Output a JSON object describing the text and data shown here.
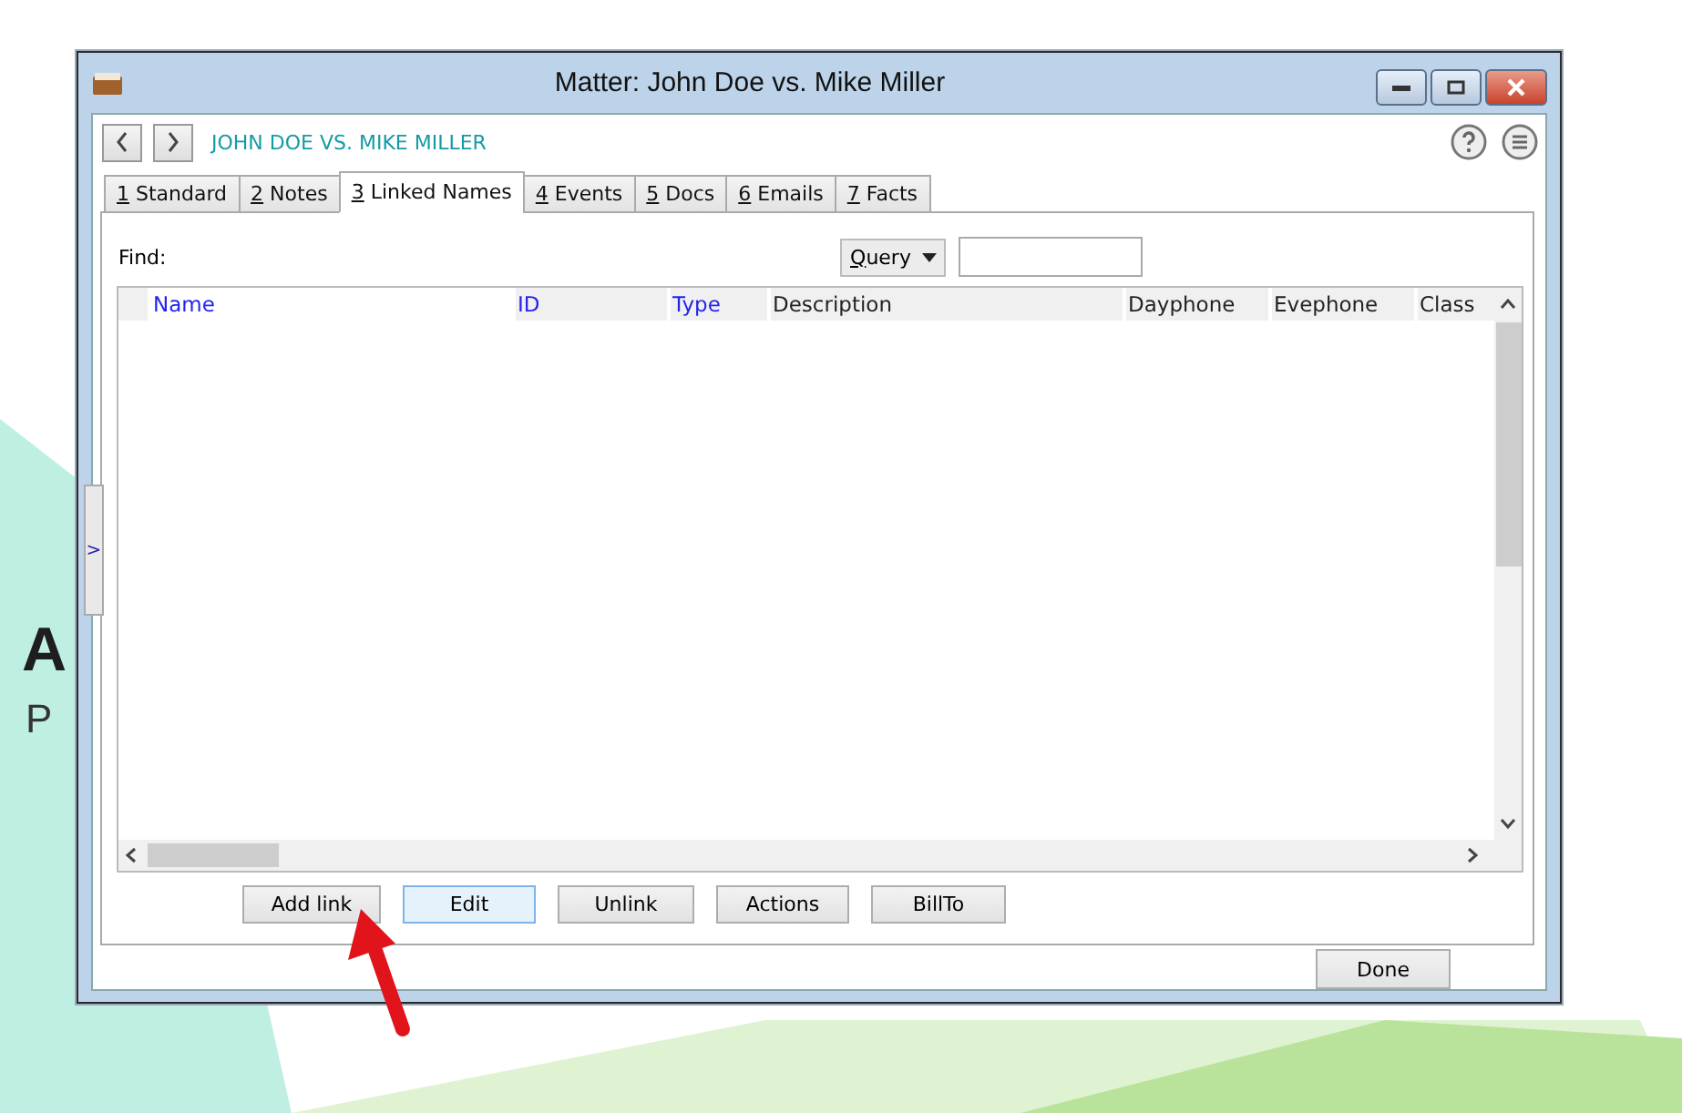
{
  "background_logo": {
    "mark": "A",
    "tagline": "P"
  },
  "window": {
    "title": "Matter: John Doe vs. Mike Miller"
  },
  "matter_heading": "JOHN DOE VS. MIKE MILLER",
  "tabs": [
    {
      "key": "1",
      "text": "Standard",
      "selected": false
    },
    {
      "key": "2",
      "text": "Notes",
      "selected": false
    },
    {
      "key": "3",
      "text": "Linked Names",
      "selected": true
    },
    {
      "key": "4",
      "text": "Events",
      "selected": false
    },
    {
      "key": "5",
      "text": "Docs",
      "selected": false
    },
    {
      "key": "6",
      "text": "Emails",
      "selected": false
    },
    {
      "key": "7",
      "text": "Facts",
      "selected": false
    }
  ],
  "side_panel_toggle": ">",
  "find": {
    "label": "Find:",
    "mode_key": "Q",
    "mode_rest": "uery"
  },
  "table": {
    "columns": [
      {
        "label": "Name",
        "sortable": true
      },
      {
        "label": "ID",
        "sortable": true
      },
      {
        "label": "Type",
        "sortable": true
      },
      {
        "label": "Description",
        "sortable": false
      },
      {
        "label": "Dayphone",
        "sortable": false
      },
      {
        "label": "Evephone",
        "sortable": false
      },
      {
        "label": "Class",
        "sortable": false
      }
    ]
  },
  "actions": [
    {
      "label": "Add link",
      "default": false
    },
    {
      "label": "Edit",
      "default": true
    },
    {
      "label": "Unlink",
      "default": false
    },
    {
      "label": "Actions",
      "default": false
    },
    {
      "label": "BillTo",
      "default": false
    }
  ],
  "done_button": "Done"
}
